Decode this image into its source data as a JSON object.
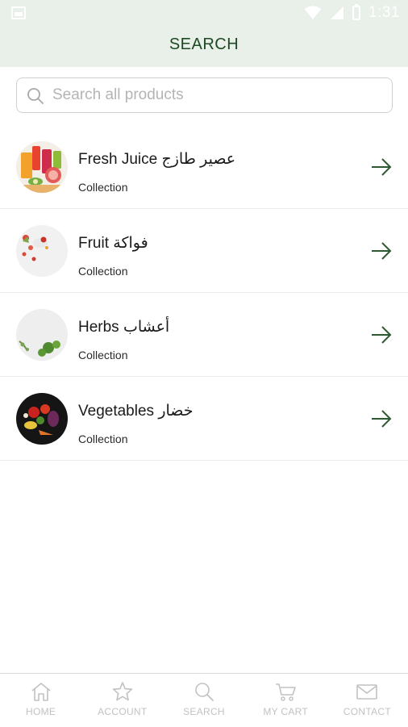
{
  "status_bar": {
    "time": "1:31"
  },
  "header": {
    "title": "SEARCH"
  },
  "search": {
    "placeholder": "Search all products",
    "value": ""
  },
  "collections": [
    {
      "title": "Fresh Juice عصير طازج",
      "subtitle": "Collection",
      "image": "fresh-juice-thumbnail"
    },
    {
      "title": "Fruit فواكة",
      "subtitle": "Collection",
      "image": "fruit-thumbnail"
    },
    {
      "title": "Herbs أعشاب",
      "subtitle": "Collection",
      "image": "herbs-thumbnail"
    },
    {
      "title": "Vegetables خضار",
      "subtitle": "Collection",
      "image": "vegetables-thumbnail"
    }
  ],
  "bottom_nav": [
    {
      "label": "HOME",
      "icon": "home-icon"
    },
    {
      "label": "ACCOUNT",
      "icon": "star-icon"
    },
    {
      "label": "SEARCH",
      "icon": "search-icon"
    },
    {
      "label": "MY CART",
      "icon": "cart-icon"
    },
    {
      "label": "CONTACT",
      "icon": "mail-icon"
    }
  ],
  "colors": {
    "header_bg": "#e9efe9",
    "title_green": "#1d4a22",
    "arrow_green": "#2e5a33",
    "nav_inactive": "#c2c2c2"
  }
}
